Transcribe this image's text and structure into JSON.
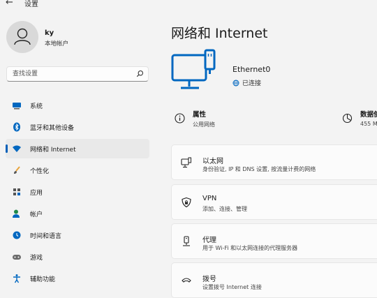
{
  "window": {
    "title": "设置"
  },
  "user": {
    "name": "ky",
    "account_type": "本地帐户"
  },
  "search": {
    "placeholder": "查找设置"
  },
  "nav": [
    {
      "label": "系统",
      "icon": "monitor-icon"
    },
    {
      "label": "蓝牙和其他设备",
      "icon": "bluetooth-icon"
    },
    {
      "label": "网络和 Internet",
      "icon": "wifi-icon",
      "selected": true
    },
    {
      "label": "个性化",
      "icon": "brush-icon"
    },
    {
      "label": "应用",
      "icon": "apps-icon"
    },
    {
      "label": "帐户",
      "icon": "person-icon"
    },
    {
      "label": "时间和语言",
      "icon": "clock-globe-icon"
    },
    {
      "label": "游戏",
      "icon": "gamepad-icon"
    },
    {
      "label": "辅助功能",
      "icon": "accessibility-icon"
    }
  ],
  "main": {
    "title": "网络和 Internet",
    "adapter": {
      "name": "Ethernet0",
      "status": "已连接"
    },
    "properties": [
      {
        "title": "属性",
        "subtitle": "公用网络",
        "icon": "info-icon"
      },
      {
        "title": "数据使",
        "subtitle": "455 M",
        "icon": "data-usage-icon"
      }
    ],
    "cards": [
      {
        "title": "以太网",
        "subtitle": "身份验证, IP 和 DNS 设置, 按流量计费的网络",
        "icon": "ethernet-icon"
      },
      {
        "title": "VPN",
        "subtitle": "添加、连接、管理",
        "icon": "shield-icon"
      },
      {
        "title": "代理",
        "subtitle": "用于 Wi-Fi 和以太网连接的代理服务器",
        "icon": "proxy-icon"
      },
      {
        "title": "拨号",
        "subtitle": "设置拨号 Internet 连接",
        "icon": "dialup-icon"
      }
    ]
  },
  "colors": {
    "accent": "#005fb8",
    "selected_bg": "#e9e9e9",
    "background": "#f3f3f3"
  }
}
